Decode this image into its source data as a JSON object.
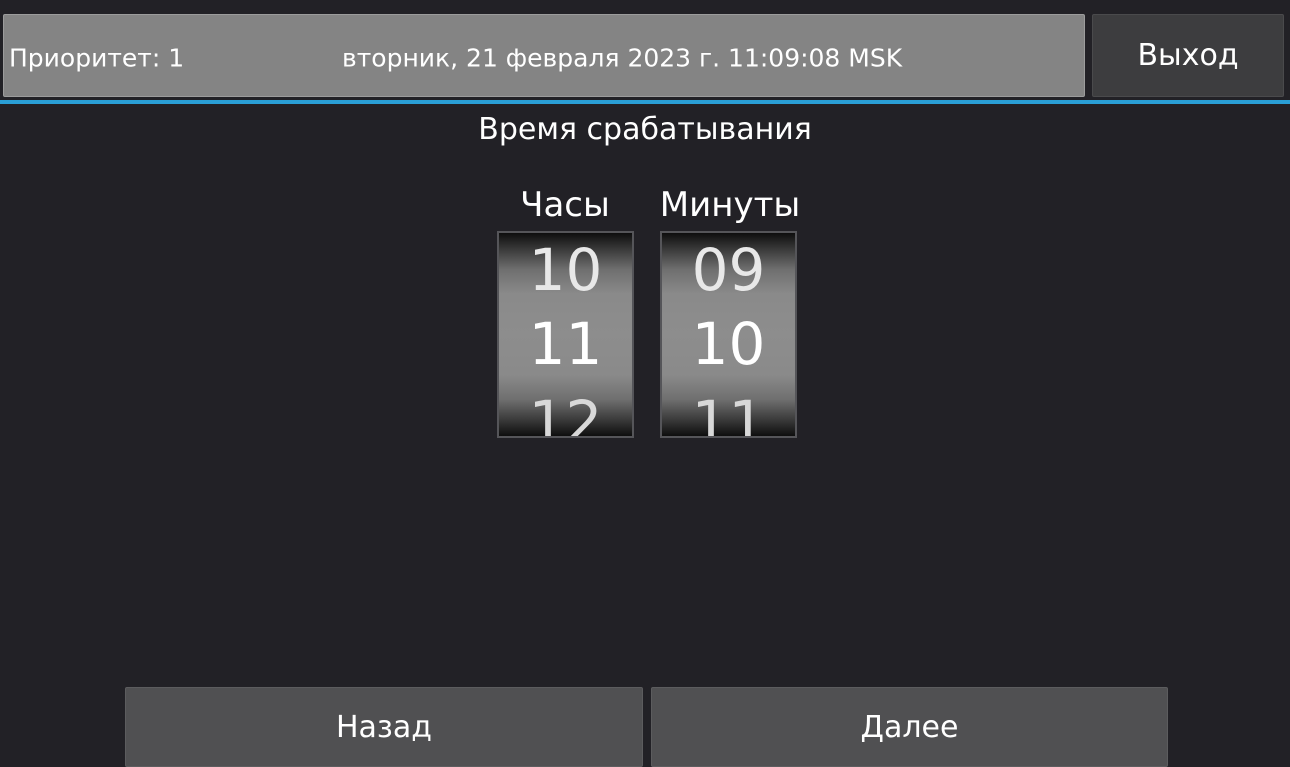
{
  "header": {
    "priority_text": "Приоритет: 1",
    "datetime_text": "вторник, 21 февраля 2023 г. 11:09:08 MSK",
    "exit_label": "Выход"
  },
  "main": {
    "title": "Время срабатывания",
    "hours": {
      "label": "Часы",
      "prev": "10",
      "current": "11",
      "next": "12"
    },
    "minutes": {
      "label": "Минуты",
      "prev": "09",
      "current": "10",
      "next": "11"
    }
  },
  "footer": {
    "back_label": "Назад",
    "next_label": "Далее"
  },
  "colors": {
    "background": "#222126",
    "status_bar": "#848484",
    "accent": "#2a9fd6",
    "button": "#505052",
    "exit_button": "#3d3d3f"
  }
}
